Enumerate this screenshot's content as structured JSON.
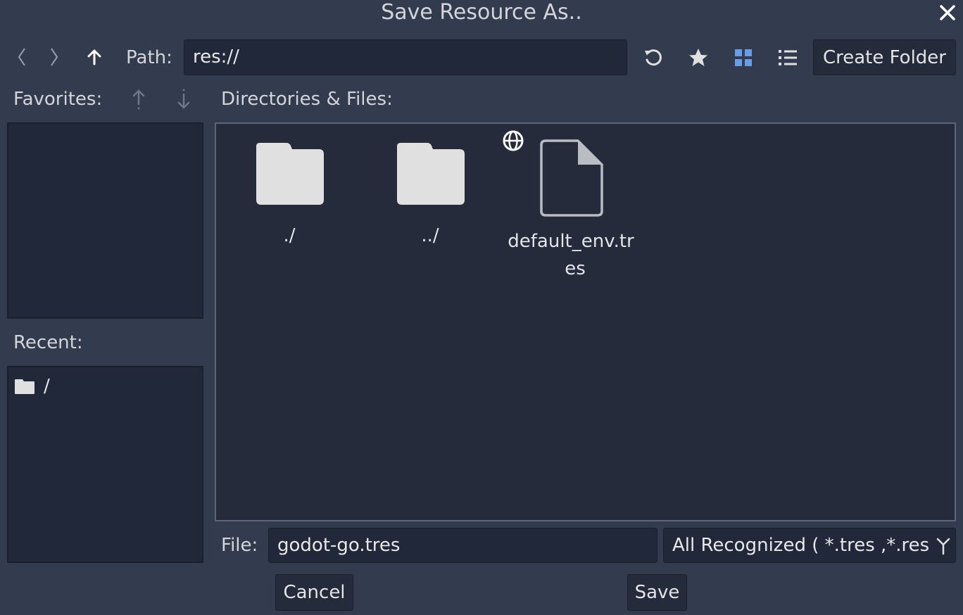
{
  "dialog": {
    "title": "Save Resource As.."
  },
  "toolbar": {
    "path_label": "Path:",
    "path_value": "res://",
    "create_folder_label": "Create Folder"
  },
  "favorites": {
    "label": "Favorites:"
  },
  "recent": {
    "label": "Recent:",
    "items": [
      {
        "name": "/"
      }
    ]
  },
  "files": {
    "label": "Directories & Files:",
    "items": [
      {
        "name": "./",
        "type": "folder"
      },
      {
        "name": "../",
        "type": "folder"
      },
      {
        "name_line1": "default_env.tr",
        "name_line2": "es",
        "type": "file"
      }
    ]
  },
  "footer": {
    "file_label": "File:",
    "file_value": "godot-go.tres",
    "filter_value": "All Recognized ( *.tres ,*.res",
    "cancel_label": "Cancel",
    "save_label": "Save"
  },
  "colors": {
    "background": "#333b4f",
    "panel": "#21283a",
    "accent": "#6a9ce8",
    "icon": "#e0e0e0"
  }
}
